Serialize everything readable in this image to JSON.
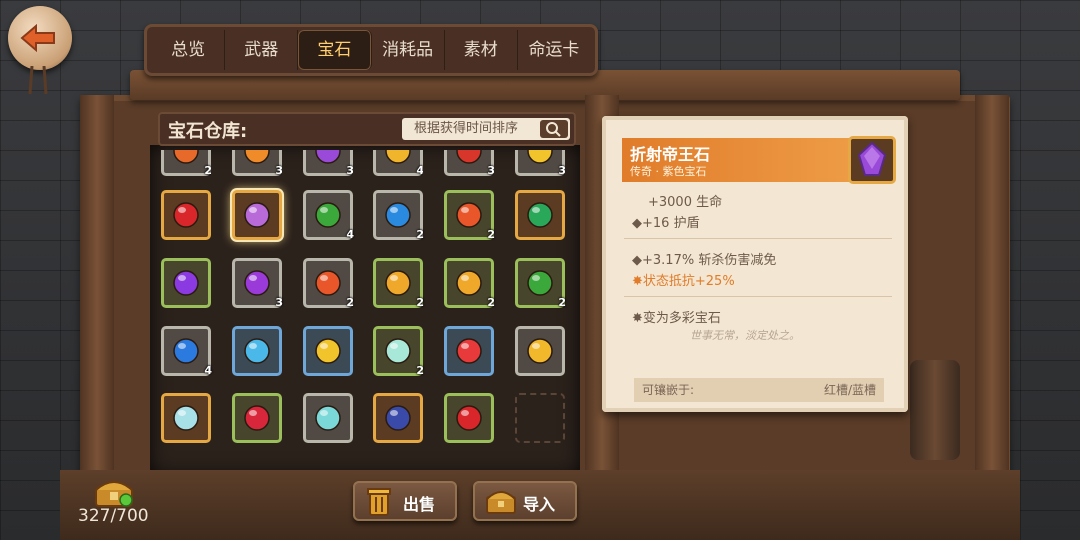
{
  "tabs": [
    {
      "label": "总览",
      "active": false
    },
    {
      "label": "武器",
      "active": false
    },
    {
      "label": "宝石",
      "active": true
    },
    {
      "label": "消耗品",
      "active": false
    },
    {
      "label": "素材",
      "active": false
    },
    {
      "label": "命运卡",
      "active": false
    }
  ],
  "warehouse": {
    "title": "宝石仓库:",
    "sort_placeholder": "根据获得时间排序"
  },
  "gems_partial_row": [
    {
      "color": "#e86a2a",
      "count": "2"
    },
    {
      "color": "#f08b2a",
      "count": "3"
    },
    {
      "color": "#9a4ad8",
      "count": "3"
    },
    {
      "color": "#f0b52a",
      "count": "4"
    },
    {
      "color": "#d8362a",
      "count": "3"
    },
    {
      "color": "#f0c42a",
      "count": "3"
    }
  ],
  "gems": [
    {
      "color": "#d8262a",
      "rarity": "gold",
      "count": ""
    },
    {
      "color": "#b86ad8",
      "rarity": "gold",
      "count": "",
      "selected": true
    },
    {
      "color": "#3aa83a",
      "rarity": "silver",
      "count": "4"
    },
    {
      "color": "#2a8ae0",
      "rarity": "silver",
      "count": "2"
    },
    {
      "color": "#e8562a",
      "rarity": "green",
      "count": "2"
    },
    {
      "color": "#2aa85a",
      "rarity": "gold",
      "count": ""
    },
    {
      "color": "#8a3ae0",
      "rarity": "green",
      "count": ""
    },
    {
      "color": "#9a3ad8",
      "rarity": "silver",
      "count": "3"
    },
    {
      "color": "#e8562a",
      "rarity": "silver",
      "count": "2"
    },
    {
      "color": "#f0a82a",
      "rarity": "green",
      "count": "2"
    },
    {
      "color": "#f0a82a",
      "rarity": "green",
      "count": "2"
    },
    {
      "color": "#3aa83a",
      "rarity": "green",
      "count": "2"
    },
    {
      "color": "#2a7ae0",
      "rarity": "silver",
      "count": "4"
    },
    {
      "color": "#4ab8e8",
      "rarity": "blue",
      "count": ""
    },
    {
      "color": "#f0c42a",
      "rarity": "blue",
      "count": ""
    },
    {
      "color": "#a8e8d8",
      "rarity": "green",
      "count": "2"
    },
    {
      "color": "#e83a3a",
      "rarity": "blue",
      "count": ""
    },
    {
      "color": "#f0b82a",
      "rarity": "silver",
      "count": ""
    },
    {
      "color": "#a8e0e8",
      "rarity": "gold",
      "count": ""
    },
    {
      "color": "#d8263a",
      "rarity": "green",
      "count": ""
    },
    {
      "color": "#7ad8d8",
      "rarity": "silver",
      "count": ""
    },
    {
      "color": "#3a4aa8",
      "rarity": "gold",
      "count": ""
    },
    {
      "color": "#d8262a",
      "rarity": "green",
      "count": ""
    },
    {
      "color": "",
      "rarity": "empty",
      "count": ""
    }
  ],
  "detail": {
    "name": "折射帝王石",
    "subtitle": "传奇 · 紫色宝石",
    "stat1": "+3000 生命",
    "stat2": "◆+16 护盾",
    "stat3": "◆+3.17% 斩杀伤害减免",
    "stat4": "✸状态抵抗+25%",
    "effect": "✸变为多彩宝石",
    "flavor": "世事无常，淡定处之。",
    "socket_label": "可镶嵌于:",
    "socket_value": "红槽/蓝槽",
    "icon_color": "#9a4ad8"
  },
  "footer": {
    "capacity": "327/700",
    "sell_label": "出售",
    "import_label": "导入"
  }
}
